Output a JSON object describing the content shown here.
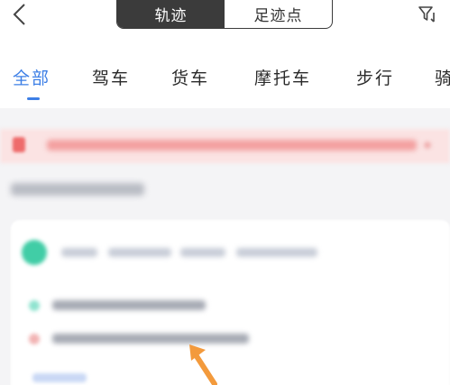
{
  "header": {
    "tabs": [
      {
        "label": "轨迹",
        "active": true
      },
      {
        "label": "足迹点",
        "active": false
      }
    ]
  },
  "categories": [
    {
      "label": "全部",
      "active": true
    },
    {
      "label": "驾车",
      "active": false
    },
    {
      "label": "货车",
      "active": false
    },
    {
      "label": "摩托车",
      "active": false
    },
    {
      "label": "步行",
      "active": false
    },
    {
      "label": "骑",
      "active": false
    }
  ],
  "icons": {
    "back": "chevron-left-icon",
    "filter": "filter-icon",
    "banner": "alert-icon",
    "pointer": "arrow-pointer-icon"
  },
  "colors": {
    "accent": "#3d7fe6",
    "segment_active": "#3b3b3b",
    "banner_bg": "#fbe3e3",
    "avatar": "#41cda6",
    "pointer_arrow": "#f39a3c"
  }
}
